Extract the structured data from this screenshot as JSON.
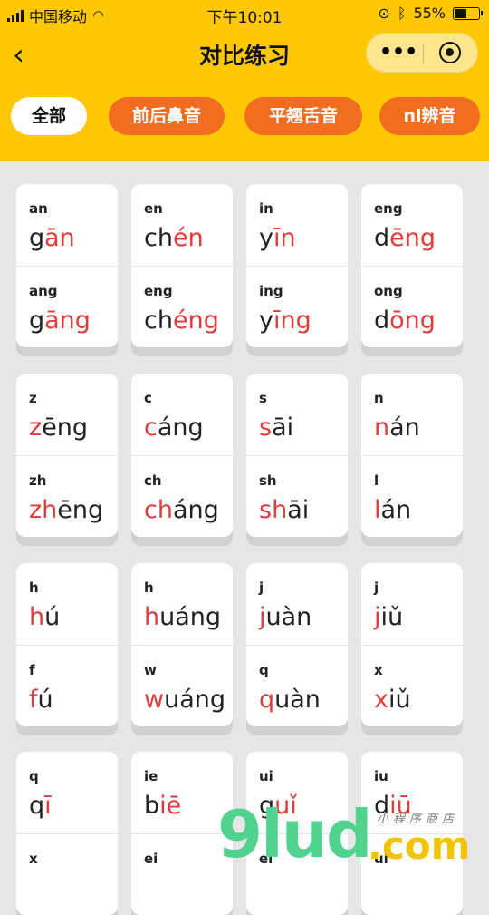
{
  "status": {
    "carrier": "中国移动",
    "time": "下午10:01",
    "battery_pct": "55%",
    "battery_level": 0.55
  },
  "nav": {
    "title": "对比练习",
    "back": "‹",
    "more": "•••"
  },
  "tabs": [
    "全部",
    "前后鼻音",
    "平翘舌音",
    "nl辨音"
  ],
  "cards": [
    {
      "top": {
        "label": "an",
        "pre": "g",
        "red": "ān",
        "post": ""
      },
      "bottom": {
        "label": "ang",
        "pre": "g",
        "red": "āng",
        "post": ""
      }
    },
    {
      "top": {
        "label": "en",
        "pre": "ch",
        "red": "én",
        "post": ""
      },
      "bottom": {
        "label": "eng",
        "pre": "ch",
        "red": "éng",
        "post": ""
      }
    },
    {
      "top": {
        "label": "in",
        "pre": "y",
        "red": "īn",
        "post": ""
      },
      "bottom": {
        "label": "ing",
        "pre": "y",
        "red": "īng",
        "post": ""
      }
    },
    {
      "top": {
        "label": "eng",
        "pre": "d",
        "red": "ēng",
        "post": ""
      },
      "bottom": {
        "label": "ong",
        "pre": "d",
        "red": "ōng",
        "post": ""
      }
    },
    {
      "top": {
        "label": "z",
        "pre": "",
        "red": "z",
        "post": "ēng"
      },
      "bottom": {
        "label": "zh",
        "pre": "",
        "red": "zh",
        "post": "ēng"
      }
    },
    {
      "top": {
        "label": "c",
        "pre": "",
        "red": "c",
        "post": "áng"
      },
      "bottom": {
        "label": "ch",
        "pre": "",
        "red": "ch",
        "post": "áng"
      }
    },
    {
      "top": {
        "label": "s",
        "pre": "",
        "red": "s",
        "post": "āi"
      },
      "bottom": {
        "label": "sh",
        "pre": "",
        "red": "sh",
        "post": "āi"
      }
    },
    {
      "top": {
        "label": "n",
        "pre": "",
        "red": "n",
        "post": "án"
      },
      "bottom": {
        "label": "l",
        "pre": "",
        "red": "l",
        "post": "án"
      }
    },
    {
      "top": {
        "label": "h",
        "pre": "",
        "red": "h",
        "post": "ú"
      },
      "bottom": {
        "label": "f",
        "pre": "",
        "red": "f",
        "post": "ú"
      }
    },
    {
      "top": {
        "label": "h",
        "pre": "",
        "red": "h",
        "post": "uáng"
      },
      "bottom": {
        "label": "w",
        "pre": "",
        "red": "w",
        "post": "uáng"
      }
    },
    {
      "top": {
        "label": "j",
        "pre": "",
        "red": "j",
        "post": "uàn"
      },
      "bottom": {
        "label": "q",
        "pre": "",
        "red": "q",
        "post": "uàn"
      }
    },
    {
      "top": {
        "label": "j",
        "pre": "",
        "red": "j",
        "post": "iǔ"
      },
      "bottom": {
        "label": "x",
        "pre": "",
        "red": "x",
        "post": "iǔ"
      }
    },
    {
      "top": {
        "label": "q",
        "pre": "q",
        "red": "ī",
        "post": ""
      },
      "bottom": {
        "label": "x",
        "pre": "",
        "red": "",
        "post": ""
      }
    },
    {
      "top": {
        "label": "ie",
        "pre": "b",
        "red": "iē",
        "post": ""
      },
      "bottom": {
        "label": "ei",
        "pre": "",
        "red": "",
        "post": ""
      }
    },
    {
      "top": {
        "label": "ui",
        "pre": "g",
        "red": "uǐ",
        "post": ""
      },
      "bottom": {
        "label": "ei",
        "pre": "",
        "red": "",
        "post": ""
      }
    },
    {
      "top": {
        "label": "iu",
        "pre": "d",
        "red": "iū",
        "post": ""
      },
      "bottom": {
        "label": "ui",
        "pre": "",
        "red": "",
        "post": ""
      }
    }
  ],
  "watermark": {
    "brand": "9lud",
    "suffix": ".com",
    "tagline": "小程序商店"
  }
}
